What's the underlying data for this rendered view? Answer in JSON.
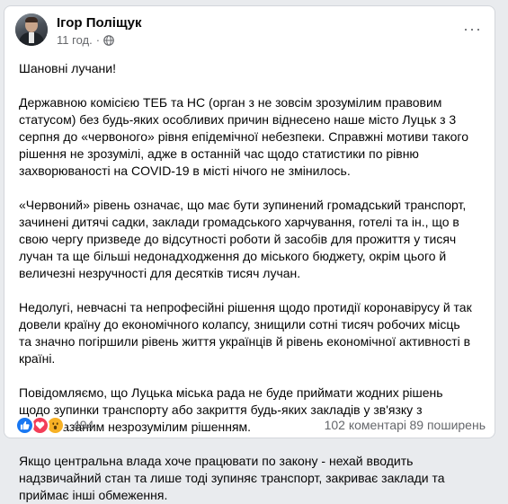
{
  "post": {
    "author": "Ігор Поліщук",
    "time": "11 год.",
    "separator": "·",
    "paragraphs": [
      "Шановні лучани!",
      "Державною комісією ТЕБ та НС (орган з не зовсім зрозумілим правовим статусом) без будь-яких особливих причин віднесено наше місто Луцьк з 3 серпня до «червоного» рівня епідемічної небезпеки. Справжні мотиви такого рішення не зрозумілі, адже в останній час щодо статистики по рівню захворюваності на COVID-19 в місті нічого не змінилось.",
      "«Червоний» рівень означає, що має бути зупинений громадський транспорт, зачинені дитячі садки, заклади громадського харчування, готелі та ін., що в свою чергу призведе до відсутності роботи й засобів для прожиття у тисяч лучан та ще більші недонадходження до міського бюджету, окрім цього й величезні незручності для десятків тисяч лучан.",
      "Недолугі, невчасні та непрофесійні рішення щодо протидії коронавірусу й так довели країну до економічного колапсу, знищили сотні тисяч робочих місць та значно погіршили рівень життя українців й рівень економічної активності в країні.",
      "Повідомляємо, що Луцька міська рада не буде приймати жодних рішень щодо зупинки транспорту або закриття будь-яких закладів у зв'язку з вищевказаним незрозумілим рішенням.",
      "Якщо центральна влада хоче працювати по закону - нехай вводить надзвичайний стан та лише тоді зупиняє транспорт, закриває заклади та приймає інші обмеження."
    ],
    "more_label": "···"
  },
  "footer": {
    "reaction_count": "494",
    "comments": "102 коментарі",
    "shares": "89 поширень",
    "reaction_icons": [
      "like-icon",
      "love-icon",
      "wow-icon"
    ]
  },
  "colors": {
    "like": "#1877f2",
    "love": "#f33e58",
    "wow": "#f7b125",
    "meta_text": "#65676b"
  }
}
